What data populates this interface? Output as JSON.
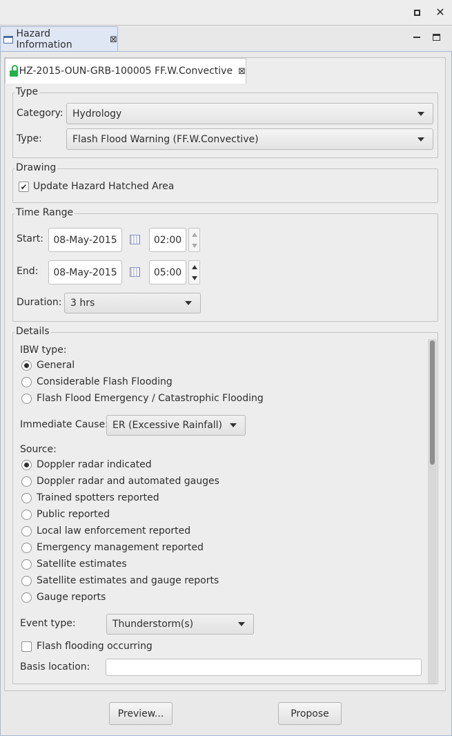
{
  "view": {
    "title": "Hazard Information",
    "editor_tab_title": "HZ-2015-OUN-GRB-100005 FF.W.Convective"
  },
  "type_group": {
    "label": "Type",
    "category_label": "Category:",
    "category_value": "Hydrology",
    "type_label": "Type:",
    "type_value": "Flash Flood Warning (FF.W.Convective)"
  },
  "drawing_group": {
    "label": "Drawing",
    "update_hatched_label": "Update Hazard Hatched Area",
    "update_hatched_checked": true
  },
  "time_range": {
    "label": "Time Range",
    "start_label": "Start:",
    "start_date": "08-May-2015",
    "start_time": "02:00",
    "end_label": "End:",
    "end_date": "08-May-2015",
    "end_time": "05:00",
    "duration_label": "Duration:",
    "duration_value": "3 hrs"
  },
  "details": {
    "label": "Details",
    "ibw_label": "IBW type:",
    "ibw_options": [
      {
        "label": "General",
        "selected": true
      },
      {
        "label": "Considerable Flash Flooding",
        "selected": false
      },
      {
        "label": "Flash Flood Emergency / Catastrophic Flooding",
        "selected": false
      }
    ],
    "immediate_cause_label": "Immediate Cause:",
    "immediate_cause_value": "ER (Excessive Rainfall)",
    "source_label": "Source:",
    "source_options": [
      {
        "label": "Doppler radar indicated",
        "selected": true
      },
      {
        "label": "Doppler radar and automated gauges",
        "selected": false
      },
      {
        "label": "Trained spotters reported",
        "selected": false
      },
      {
        "label": "Public reported",
        "selected": false
      },
      {
        "label": "Local law enforcement reported",
        "selected": false
      },
      {
        "label": "Emergency management reported",
        "selected": false
      },
      {
        "label": "Satellite estimates",
        "selected": false
      },
      {
        "label": "Satellite estimates and gauge reports",
        "selected": false
      },
      {
        "label": "Gauge reports",
        "selected": false
      }
    ],
    "event_type_label": "Event type:",
    "event_type_value": "Thunderstorm(s)",
    "flash_flooding_label": "Flash flooding occurring",
    "flash_flooding_checked": false,
    "basis_location_label": "Basis location:",
    "basis_location_value": ""
  },
  "buttons": {
    "preview": "Preview...",
    "propose": "Propose"
  },
  "icons": {
    "lock": "unlocked-lock-icon",
    "lock_color": "#1fb24a"
  }
}
